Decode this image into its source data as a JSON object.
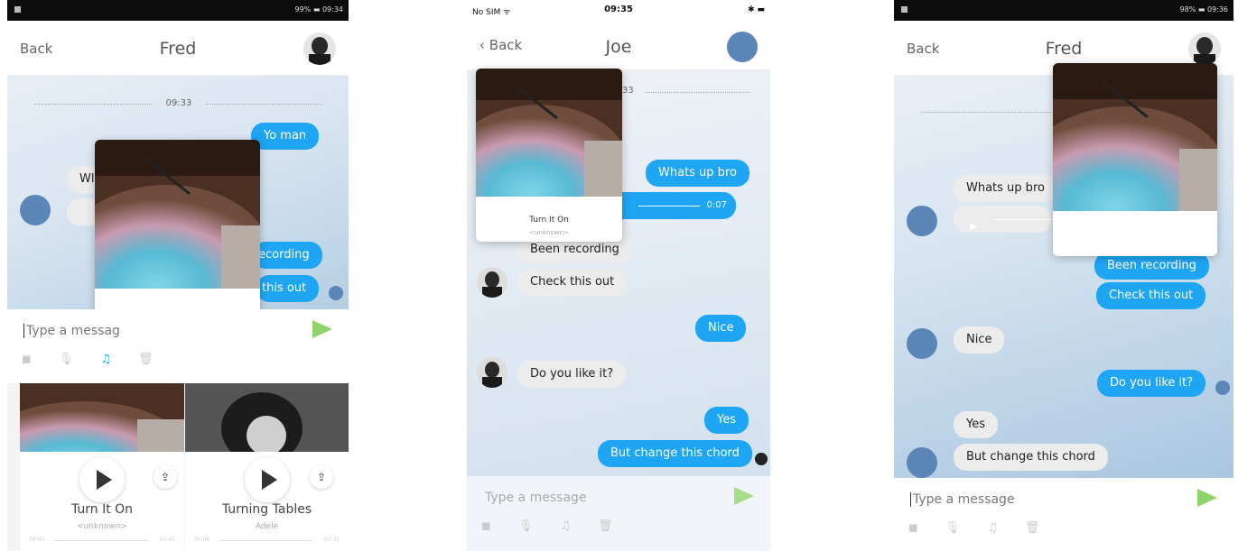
{
  "screen1": {
    "status_time": "09:34",
    "status_battery": "99%",
    "back_label": "Back",
    "title": "Fred",
    "time_divider": "09:33",
    "msg_yo_man": "Yo man",
    "msg_partial_in": "Wl",
    "msg_recording": "ecording",
    "msg_this_out": "this out",
    "input_placeholder": "Type a messag",
    "tiles": [
      {
        "title": "Turn It On",
        "subtitle": "<unknown>",
        "start": "00:00",
        "end": "03:41"
      },
      {
        "title": "Turning Tables",
        "subtitle": "Adele",
        "start": "00:00",
        "end": "03:31"
      }
    ]
  },
  "screen2": {
    "status_carrier": "No SIM",
    "status_time": "09:35",
    "back_label": "Back",
    "title": "Joe",
    "time_partial": "33",
    "card_title": "Turn It On",
    "card_subtitle": "<unknown>",
    "msg_whats_up": "Whats up bro",
    "audio_duration": "0:07",
    "msg_been_recording": "Been recording",
    "msg_check_this_out": "Check this out",
    "msg_nice": "Nice",
    "msg_do_you_like": "Do you like it?",
    "msg_yes": "Yes",
    "msg_change_chord": "But change this chord",
    "input_placeholder": "Type a message"
  },
  "screen3": {
    "status_time": "09:36",
    "status_battery": "98%",
    "back_label": "Back",
    "title": "Fred",
    "msg_whats_up": "Whats up bro",
    "msg_been_recording": "Been recording",
    "msg_check_this_out": "Check this out",
    "msg_nice": "Nice",
    "msg_do_you_like": "Do you like it?",
    "msg_yes": "Yes",
    "msg_change_chord": "But change this chord",
    "input_placeholder": "Type a message"
  },
  "icons": {
    "camera": "camera-icon",
    "mic": "microphone-icon",
    "music": "music-note-icon",
    "trash": "trash-icon",
    "send": "send-icon",
    "play": "play-icon",
    "share": "share-icon"
  },
  "colors": {
    "accent": "#1ea5f3",
    "send": "#8fd36b",
    "incoming": "#ececec"
  }
}
